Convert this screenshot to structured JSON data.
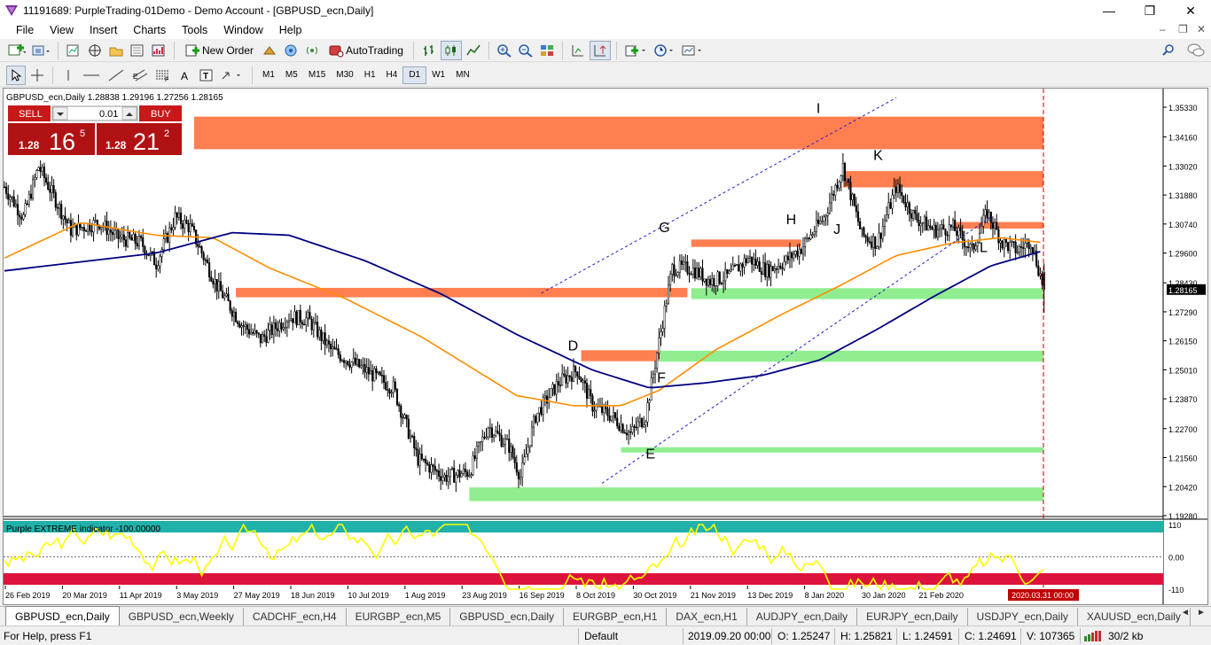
{
  "window": {
    "title": "11191689: PurpleTrading-01Demo - Demo Account - [GBPUSD_ecn,Daily]",
    "min_glyph": "—",
    "max_glyph": "❐",
    "close_glyph": "✕",
    "mdi_min": "–",
    "mdi_restore": "❐",
    "mdi_close": "✕"
  },
  "menu": [
    "File",
    "View",
    "Insert",
    "Charts",
    "Tools",
    "Window",
    "Help"
  ],
  "toolbar": {
    "new_order": "New Order",
    "autotrading": "AutoTrading",
    "timeframes": [
      "M1",
      "M5",
      "M15",
      "M30",
      "H1",
      "H4",
      "D1",
      "W1",
      "MN"
    ],
    "active_timeframe": "D1",
    "icons": [
      "new-chart-icon",
      "profiles-icon",
      "market-watch-icon",
      "navigator-icon",
      "data-window-icon",
      "terminal-icon",
      "strategy-tester-icon",
      "bar-chart-icon",
      "candlestick-icon",
      "line-chart-icon",
      "zoom-in-icon",
      "zoom-out-icon",
      "tile-icon",
      "autoscroll-icon",
      "chart-shift-icon",
      "indicators-icon",
      "periods-icon",
      "templates-icon",
      "cursor-icon",
      "crosshair-icon",
      "vertical-line-icon",
      "horizontal-line-icon",
      "trendline-icon",
      "equidistant-channel-icon",
      "fibonacci-icon",
      "text-icon",
      "text-label-icon",
      "arrows-icon",
      "search-icon",
      "chat-icon"
    ]
  },
  "chart": {
    "header": "GBPUSD_ecn,Daily  1.28838 1.29196 1.27256 1.28165",
    "indicator_header": "Purple EXTREME indicator -100.00000",
    "current_price_label": "1.28165",
    "date_marker": "2020.03.31 00:00",
    "colors": {
      "orange_zone": "#ff7f50",
      "green_zone": "#90ee90",
      "ma_fast": "#ff8c00",
      "ma_slow": "#000080",
      "channel": "#1e1ec8",
      "indicator_line": "#ffff00",
      "indicator_top": "#20b2aa",
      "indicator_bottom": "#dc143c",
      "period_line": "#c00000"
    }
  },
  "trade_panel": {
    "sell_label": "SELL",
    "buy_label": "BUY",
    "lot": "0.01",
    "sell_small": "1.28",
    "sell_big": "16",
    "sell_sup": "5",
    "buy_small": "1.28",
    "buy_big": "21",
    "buy_sup": "2"
  },
  "chart_data": {
    "type": "candlestick",
    "symbol": "GBPUSD_ecn",
    "timeframe": "Daily",
    "ohlc_last": {
      "open": 1.28838,
      "high": 1.29196,
      "low": 1.27256,
      "close": 1.28165
    },
    "y_ticks": [
      "1.35330",
      "1.34160",
      "1.33020",
      "1.31880",
      "1.30740",
      "1.29600",
      "1.28430",
      "1.27290",
      "1.26150",
      "1.25010",
      "1.23870",
      "1.22700",
      "1.21560",
      "1.20420",
      "1.19280"
    ],
    "x_ticks": [
      "26 Feb 2019",
      "20 Mar 2019",
      "11 Apr 2019",
      "3 May 2019",
      "27 May 2019",
      "18 Jun 2019",
      "10 Jul 2019",
      "1 Aug 2019",
      "23 Aug 2019",
      "16 Sep 2019",
      "8 Oct 2019",
      "30 Oct 2019",
      "21 Nov 2019",
      "13 Dec 2019",
      "8 Jan 2020",
      "30 Jan 2020",
      "21 Feb 2020"
    ],
    "indicator_ticks": [
      "110",
      "0.00",
      "-110"
    ],
    "price_path": [
      {
        "t": 0,
        "p": 1.322
      },
      {
        "t": 10,
        "p": 1.31
      },
      {
        "t": 18,
        "p": 1.33
      },
      {
        "t": 35,
        "p": 1.305
      },
      {
        "t": 50,
        "p": 1.308
      },
      {
        "t": 60,
        "p": 1.302
      },
      {
        "t": 72,
        "p": 1.3
      },
      {
        "t": 80,
        "p": 1.292
      },
      {
        "t": 90,
        "p": 1.31
      },
      {
        "t": 98,
        "p": 1.306
      },
      {
        "t": 112,
        "p": 1.283
      },
      {
        "t": 125,
        "p": 1.268
      },
      {
        "t": 135,
        "p": 1.262
      },
      {
        "t": 150,
        "p": 1.271
      },
      {
        "t": 160,
        "p": 1.27
      },
      {
        "t": 172,
        "p": 1.258
      },
      {
        "t": 190,
        "p": 1.25
      },
      {
        "t": 205,
        "p": 1.243
      },
      {
        "t": 218,
        "p": 1.215
      },
      {
        "t": 232,
        "p": 1.208
      },
      {
        "t": 245,
        "p": 1.21
      },
      {
        "t": 255,
        "p": 1.228
      },
      {
        "t": 266,
        "p": 1.22
      },
      {
        "t": 272,
        "p": 1.208
      },
      {
        "t": 280,
        "p": 1.232
      },
      {
        "t": 292,
        "p": 1.245
      },
      {
        "t": 302,
        "p": 1.25
      },
      {
        "t": 310,
        "p": 1.236
      },
      {
        "t": 320,
        "p": 1.232
      },
      {
        "t": 330,
        "p": 1.225
      },
      {
        "t": 338,
        "p": 1.232
      },
      {
        "t": 352,
        "p": 1.29
      },
      {
        "t": 362,
        "p": 1.29
      },
      {
        "t": 372,
        "p": 1.285
      },
      {
        "t": 382,
        "p": 1.287
      },
      {
        "t": 392,
        "p": 1.294
      },
      {
        "t": 402,
        "p": 1.289
      },
      {
        "t": 412,
        "p": 1.293
      },
      {
        "t": 420,
        "p": 1.298
      },
      {
        "t": 432,
        "p": 1.31
      },
      {
        "t": 442,
        "p": 1.33
      },
      {
        "t": 452,
        "p": 1.303
      },
      {
        "t": 460,
        "p": 1.3
      },
      {
        "t": 470,
        "p": 1.322
      },
      {
        "t": 480,
        "p": 1.31
      },
      {
        "t": 490,
        "p": 1.305
      },
      {
        "t": 500,
        "p": 1.306
      },
      {
        "t": 510,
        "p": 1.297
      },
      {
        "t": 518,
        "p": 1.312
      },
      {
        "t": 526,
        "p": 1.3
      },
      {
        "t": 534,
        "p": 1.297
      },
      {
        "t": 541,
        "p": 1.301
      },
      {
        "t": 548,
        "p": 1.28165
      }
    ],
    "ma_fast": [
      {
        "t": 0,
        "p": 1.294
      },
      {
        "t": 40,
        "p": 1.308
      },
      {
        "t": 80,
        "p": 1.303
      },
      {
        "t": 110,
        "p": 1.302
      },
      {
        "t": 140,
        "p": 1.29
      },
      {
        "t": 180,
        "p": 1.278
      },
      {
        "t": 220,
        "p": 1.263
      },
      {
        "t": 270,
        "p": 1.24
      },
      {
        "t": 300,
        "p": 1.236
      },
      {
        "t": 325,
        "p": 1.236
      },
      {
        "t": 345,
        "p": 1.242
      },
      {
        "t": 375,
        "p": 1.258
      },
      {
        "t": 410,
        "p": 1.272
      },
      {
        "t": 440,
        "p": 1.283
      },
      {
        "t": 470,
        "p": 1.295
      },
      {
        "t": 500,
        "p": 1.3
      },
      {
        "t": 525,
        "p": 1.302
      },
      {
        "t": 548,
        "p": 1.3
      }
    ],
    "ma_slow": [
      {
        "t": 0,
        "p": 1.289
      },
      {
        "t": 80,
        "p": 1.296
      },
      {
        "t": 120,
        "p": 1.304
      },
      {
        "t": 150,
        "p": 1.303
      },
      {
        "t": 190,
        "p": 1.293
      },
      {
        "t": 230,
        "p": 1.28
      },
      {
        "t": 270,
        "p": 1.264
      },
      {
        "t": 310,
        "p": 1.25
      },
      {
        "t": 340,
        "p": 1.243
      },
      {
        "t": 370,
        "p": 1.245
      },
      {
        "t": 400,
        "p": 1.248
      },
      {
        "t": 430,
        "p": 1.254
      },
      {
        "t": 460,
        "p": 1.266
      },
      {
        "t": 490,
        "p": 1.279
      },
      {
        "t": 520,
        "p": 1.291
      },
      {
        "t": 548,
        "p": 1.297
      }
    ],
    "zones": [
      {
        "color": "orange",
        "from_t": 100,
        "to": "end",
        "low": 1.3368,
        "high": 1.3496
      },
      {
        "color": "orange",
        "from_t": 442,
        "to": "end",
        "low": 1.3218,
        "high": 1.3282
      },
      {
        "color": "orange",
        "from_t": 500,
        "to": "end",
        "low": 1.3056,
        "high": 1.3082
      },
      {
        "color": "orange",
        "from_t": 362,
        "to_t": 420,
        "low": 1.2984,
        "high": 1.3013
      },
      {
        "color": "orange",
        "from_t": 122,
        "to_t": 360,
        "low": 1.2786,
        "high": 1.2823
      },
      {
        "color": "orange",
        "from_t": 304,
        "to_t": 345,
        "low": 1.2535,
        "high": 1.2578
      },
      {
        "color": "green",
        "from_t": 362,
        "to_t": 548,
        "low": 1.2779,
        "high": 1.2822
      },
      {
        "color": "green",
        "from_t": 345,
        "to": "end",
        "low": 1.2533,
        "high": 1.2576
      },
      {
        "color": "green",
        "from_t": 325,
        "to": "end",
        "low": 1.2176,
        "high": 1.2197
      },
      {
        "color": "green",
        "from_t": 245,
        "to": "end",
        "low": 1.1985,
        "high": 1.2039
      }
    ],
    "channel": [
      {
        "t1": 283,
        "p1": 1.2802,
        "t2": 470,
        "p2": 1.357
      },
      {
        "t1": 315,
        "p1": 1.2055,
        "t2": 520,
        "p2": 1.3102
      }
    ],
    "wave_labels": [
      {
        "label": "I",
        "t": 428,
        "p": 1.351
      },
      {
        "label": "K",
        "t": 458,
        "p": 1.3326
      },
      {
        "label": "H",
        "t": 412,
        "p": 1.3073
      },
      {
        "label": "G",
        "t": 345,
        "p": 1.3042
      },
      {
        "label": "J",
        "t": 437,
        "p": 1.3035
      },
      {
        "label": "L",
        "t": 514,
        "p": 1.2964
      },
      {
        "label": "D",
        "t": 297,
        "p": 1.2578
      },
      {
        "label": "F",
        "t": 344,
        "p": 1.2452
      },
      {
        "label": "E",
        "t": 338,
        "p": 1.2152
      }
    ],
    "indicator_range": [
      -110,
      110
    ]
  },
  "tabs": [
    "GBPUSD_ecn,Daily",
    "GBPUSD_ecn,Weekly",
    "CADCHF_ecn,H4",
    "EURGBP_ecn,M5",
    "GBPUSD_ecn,Daily",
    "EURGBP_ecn,H1",
    "DAX_ecn,H1",
    "AUDJPY_ecn,Daily",
    "EURJPY_ecn,Daily",
    "USDJPY_ecn,Daily",
    "XAUUSD_ecn,Daily"
  ],
  "active_tab": 0,
  "tab_nav": [
    "◄",
    "►"
  ],
  "status": {
    "help": "For Help, press F1",
    "profile": "Default",
    "datetime": "2019.09.20 00:00",
    "open": "O: 1.25247",
    "high": "H: 1.25821",
    "low": "L: 1.24591",
    "close": "C: 1.24691",
    "volume": "V: 107365",
    "traffic": "30/2 kb"
  }
}
